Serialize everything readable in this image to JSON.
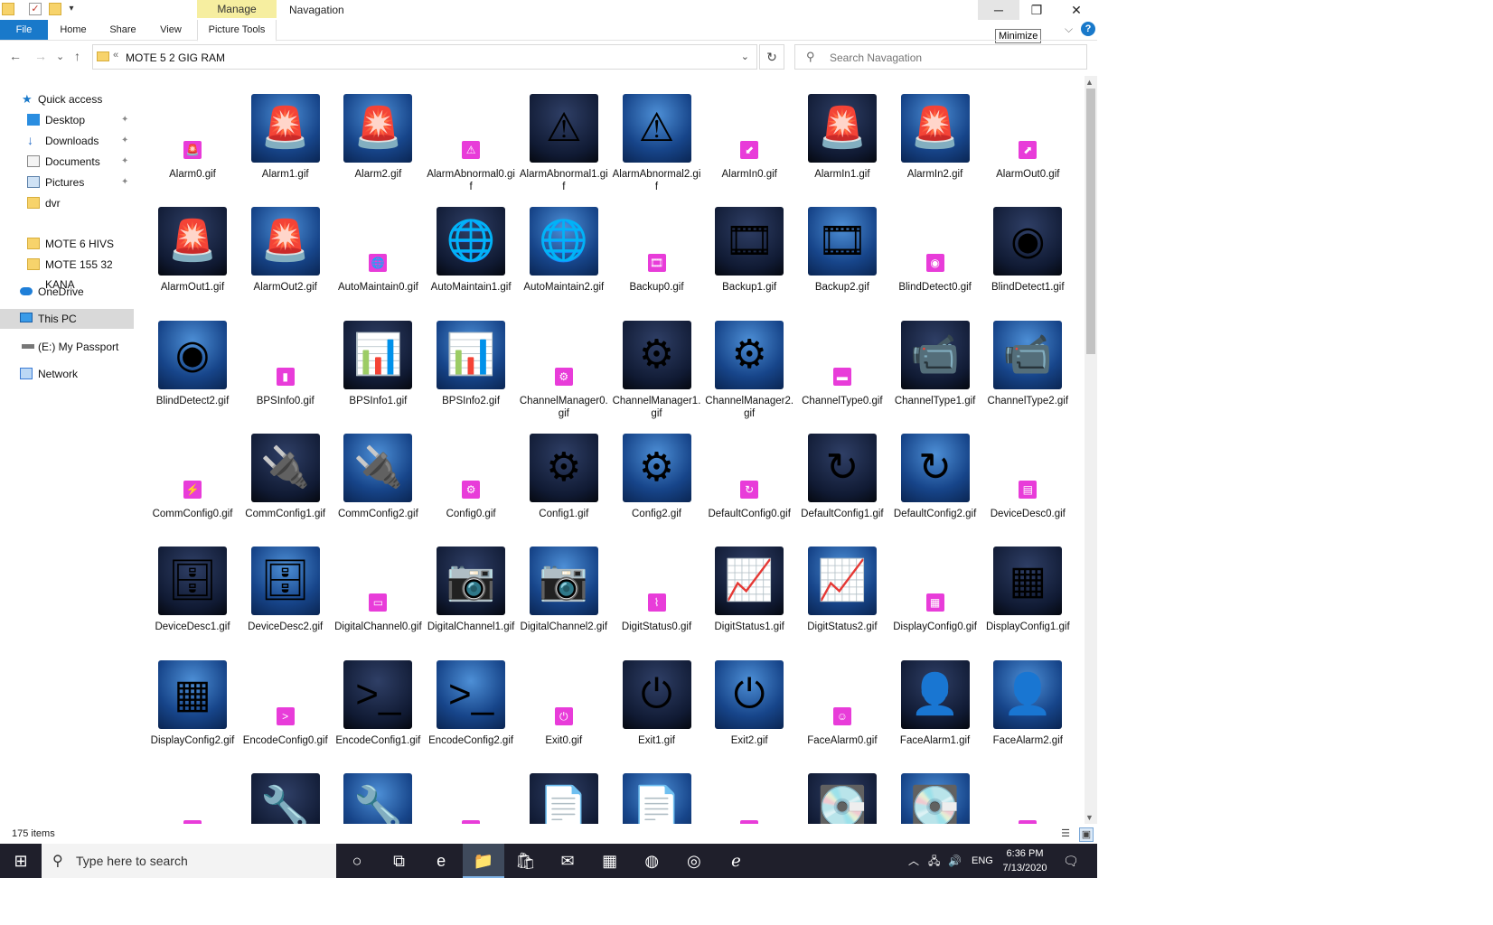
{
  "window": {
    "title": "Navagation",
    "manage_tab": "Manage",
    "minimize_symbol": "─",
    "maximize_symbol": "❐",
    "close_symbol": "✕",
    "tooltip": "Minimize"
  },
  "ribbon": {
    "tabs": [
      "File",
      "Home",
      "Share",
      "View",
      "Picture Tools"
    ],
    "collapse_symbol": "⌵",
    "help_symbol": "?"
  },
  "navbar": {
    "back": "←",
    "forward": "→",
    "recent": "⌄",
    "up": "↑",
    "chevron": "«",
    "path": "MOTE 5 2 GIG RAM",
    "dropdown": "⌄",
    "refresh": "↻",
    "search_placeholder": "Search Navagation",
    "search_icon": "⚲"
  },
  "navpane": {
    "items": [
      {
        "label": "Quick access",
        "icon": "star-icon",
        "glyph": "★"
      },
      {
        "label": "Desktop",
        "icon": "desktop-icon",
        "pinned": true
      },
      {
        "label": "Downloads",
        "icon": "download-arrow-icon",
        "pinned": true
      },
      {
        "label": "Documents",
        "icon": "documents-icon",
        "pinned": true
      },
      {
        "label": "Pictures",
        "icon": "pictures-icon",
        "pinned": true
      },
      {
        "label": "dvr",
        "icon": "folder-icon"
      },
      {
        "label": "MOTE 6 HIVS",
        "icon": "folder-icon"
      },
      {
        "label": "MOTE 155 32 KANA",
        "icon": "folder-icon"
      },
      {
        "label": "OneDrive",
        "icon": "cloud-icon"
      },
      {
        "label": "This PC",
        "icon": "computer-icon"
      },
      {
        "label": "(E:) My Passport",
        "icon": "drive-icon"
      },
      {
        "label": "Network",
        "icon": "network-icon"
      }
    ],
    "pin_glyph": "📌"
  },
  "files": [
    {
      "name": "Alarm0.gif",
      "kind": "small",
      "icon": "alarm-siren-icon",
      "glyph": "🚨"
    },
    {
      "name": "Alarm1.gif",
      "kind": "big-blue",
      "icon": "alarm-siren-blue-icon",
      "glyph": "🚨"
    },
    {
      "name": "Alarm2.gif",
      "kind": "big-blue",
      "icon": "alarm-siren-blue-icon",
      "glyph": "🚨"
    },
    {
      "name": "AlarmAbnormal0.gif",
      "kind": "small",
      "icon": "monitor-warning-icon",
      "glyph": "⚠"
    },
    {
      "name": "AlarmAbnormal1.gif",
      "kind": "big-dark",
      "icon": "monitor-warning-icon",
      "glyph": "⚠"
    },
    {
      "name": "AlarmAbnormal2.gif",
      "kind": "big-blue",
      "icon": "monitor-warning-icon",
      "glyph": "⚠"
    },
    {
      "name": "AlarmIn0.gif",
      "kind": "small",
      "icon": "alarm-in-icon",
      "glyph": "⬋"
    },
    {
      "name": "AlarmIn1.gif",
      "kind": "big-dark",
      "icon": "alarm-in-icon",
      "glyph": "🚨"
    },
    {
      "name": "AlarmIn2.gif",
      "kind": "big-blue",
      "icon": "alarm-in-icon",
      "glyph": "🚨"
    },
    {
      "name": "AlarmOut0.gif",
      "kind": "small",
      "icon": "alarm-out-icon",
      "glyph": "⬈"
    },
    {
      "name": "AlarmOut1.gif",
      "kind": "big-dark",
      "icon": "alarm-out-icon",
      "glyph": "🚨"
    },
    {
      "name": "AlarmOut2.gif",
      "kind": "big-blue",
      "icon": "alarm-out-icon",
      "glyph": "🚨"
    },
    {
      "name": "AutoMaintain0.gif",
      "kind": "small",
      "icon": "globe-cycle-icon",
      "glyph": "🌐"
    },
    {
      "name": "AutoMaintain1.gif",
      "kind": "big-dark",
      "icon": "globe-cycle-icon",
      "glyph": "🌐"
    },
    {
      "name": "AutoMaintain2.gif",
      "kind": "big-blue",
      "icon": "globe-cycle-icon",
      "glyph": "🌐"
    },
    {
      "name": "Backup0.gif",
      "kind": "small",
      "icon": "film-backup-icon",
      "glyph": "🎞"
    },
    {
      "name": "Backup1.gif",
      "kind": "big-dark",
      "icon": "film-backup-icon",
      "glyph": "🎞"
    },
    {
      "name": "Backup2.gif",
      "kind": "big-blue",
      "icon": "film-backup-icon",
      "glyph": "🎞"
    },
    {
      "name": "BlindDetect0.gif",
      "kind": "small",
      "icon": "eye-icon",
      "glyph": "◉"
    },
    {
      "name": "BlindDetect1.gif",
      "kind": "big-dark",
      "icon": "eye-icon",
      "glyph": "◉"
    },
    {
      "name": "BlindDetect2.gif",
      "kind": "big-blue",
      "icon": "eye-icon",
      "glyph": "◉"
    },
    {
      "name": "BPSInfo0.gif",
      "kind": "small",
      "icon": "bar-chart-icon",
      "glyph": "▮"
    },
    {
      "name": "BPSInfo1.gif",
      "kind": "big-dark",
      "icon": "bar-chart-icon",
      "glyph": "📊"
    },
    {
      "name": "BPSInfo2.gif",
      "kind": "big-blue",
      "icon": "bar-chart-icon",
      "glyph": "📊"
    },
    {
      "name": "ChannelManager0.gif",
      "kind": "small",
      "icon": "camera-gear-icon",
      "glyph": "⚙"
    },
    {
      "name": "ChannelManager1.gif",
      "kind": "big-dark",
      "icon": "camera-gear-icon",
      "glyph": "⚙"
    },
    {
      "name": "ChannelManager2.gif",
      "kind": "big-blue",
      "icon": "camera-gear-icon",
      "glyph": "⚙"
    },
    {
      "name": "ChannelType0.gif",
      "kind": "small",
      "icon": "cameras-recorder-icon",
      "glyph": "▬"
    },
    {
      "name": "ChannelType1.gif",
      "kind": "big-dark",
      "icon": "cameras-recorder-icon",
      "glyph": "📹"
    },
    {
      "name": "ChannelType2.gif",
      "kind": "big-blue",
      "icon": "cameras-recorder-icon",
      "glyph": "📹"
    },
    {
      "name": "CommConfig0.gif",
      "kind": "small",
      "icon": "cable-connector-icon",
      "glyph": "⚡"
    },
    {
      "name": "CommConfig1.gif",
      "kind": "big-dark",
      "icon": "cable-connector-icon",
      "glyph": "🔌"
    },
    {
      "name": "CommConfig2.gif",
      "kind": "big-blue",
      "icon": "cable-connector-icon",
      "glyph": "🔌"
    },
    {
      "name": "Config0.gif",
      "kind": "small",
      "icon": "gear-icon",
      "glyph": "⚙"
    },
    {
      "name": "Config1.gif",
      "kind": "big-dark",
      "icon": "gear-icon",
      "glyph": "⚙"
    },
    {
      "name": "Config2.gif",
      "kind": "big-blue",
      "icon": "gear-icon",
      "glyph": "⚙"
    },
    {
      "name": "DefaultConfig0.gif",
      "kind": "small",
      "icon": "reset-arrow-icon",
      "glyph": "↻"
    },
    {
      "name": "DefaultConfig1.gif",
      "kind": "big-dark",
      "icon": "reset-arrow-icon",
      "glyph": "↻"
    },
    {
      "name": "DefaultConfig2.gif",
      "kind": "big-blue",
      "icon": "reset-arrow-icon",
      "glyph": "↻"
    },
    {
      "name": "DeviceDesc0.gif",
      "kind": "small",
      "icon": "server-document-icon",
      "glyph": "▤"
    },
    {
      "name": "DeviceDesc1.gif",
      "kind": "big-dark",
      "icon": "server-document-icon",
      "glyph": "🗄"
    },
    {
      "name": "DeviceDesc2.gif",
      "kind": "big-blue",
      "icon": "server-document-icon",
      "glyph": "🗄"
    },
    {
      "name": "DigitalChannel0.gif",
      "kind": "small",
      "icon": "digital-camera-icon",
      "glyph": "▭"
    },
    {
      "name": "DigitalChannel1.gif",
      "kind": "big-dark",
      "icon": "digital-camera-icon",
      "glyph": "📷"
    },
    {
      "name": "DigitalChannel2.gif",
      "kind": "big-blue",
      "icon": "digital-camera-icon",
      "glyph": "📷"
    },
    {
      "name": "DigitStatus0.gif",
      "kind": "small",
      "icon": "line-graph-icon",
      "glyph": "⌇"
    },
    {
      "name": "DigitStatus1.gif",
      "kind": "big-dark",
      "icon": "line-graph-icon",
      "glyph": "📈"
    },
    {
      "name": "DigitStatus2.gif",
      "kind": "big-blue",
      "icon": "line-graph-icon",
      "glyph": "📈"
    },
    {
      "name": "DisplayConfig0.gif",
      "kind": "small",
      "icon": "display-grid-icon",
      "glyph": "▦"
    },
    {
      "name": "DisplayConfig1.gif",
      "kind": "big-dark",
      "icon": "display-grid-icon",
      "glyph": "▦"
    },
    {
      "name": "DisplayConfig2.gif",
      "kind": "big-blue",
      "icon": "display-grid-icon",
      "glyph": "▦"
    },
    {
      "name": "EncodeConfig0.gif",
      "kind": "small",
      "icon": "terminal-gear-icon",
      "glyph": ">"
    },
    {
      "name": "EncodeConfig1.gif",
      "kind": "big-dark",
      "icon": "terminal-gear-icon",
      "glyph": ">_"
    },
    {
      "name": "EncodeConfig2.gif",
      "kind": "big-blue",
      "icon": "terminal-gear-icon",
      "glyph": ">_"
    },
    {
      "name": "Exit0.gif",
      "kind": "small",
      "icon": "power-icon",
      "glyph": "⏻"
    },
    {
      "name": "Exit1.gif",
      "kind": "big-dark",
      "icon": "power-icon",
      "glyph": "⏻"
    },
    {
      "name": "Exit2.gif",
      "kind": "big-blue",
      "icon": "power-icon",
      "glyph": "⏻"
    },
    {
      "name": "FaceAlarm0.gif",
      "kind": "small",
      "icon": "face-person-icon",
      "glyph": "☺"
    },
    {
      "name": "FaceAlarm1.gif",
      "kind": "big-dark",
      "icon": "face-person-icon",
      "glyph": "👤"
    },
    {
      "name": "FaceAlarm2.gif",
      "kind": "big-blue",
      "icon": "face-person-icon",
      "glyph": "👤"
    },
    {
      "name": "",
      "kind": "small",
      "icon": "partial-small-icon",
      "glyph": ""
    },
    {
      "name": "",
      "kind": "big-dark",
      "icon": "wrench-screwdriver-icon",
      "glyph": "🔧"
    },
    {
      "name": "",
      "kind": "big-blue",
      "icon": "wrench-screwdriver-icon",
      "glyph": "🔧"
    },
    {
      "name": "",
      "kind": "small",
      "icon": "partial-small-icon",
      "glyph": ""
    },
    {
      "name": "",
      "kind": "big-dark",
      "icon": "log-document-icon",
      "glyph": "📄"
    },
    {
      "name": "",
      "kind": "big-blue",
      "icon": "log-document-icon",
      "glyph": "📄"
    },
    {
      "name": "",
      "kind": "small",
      "icon": "partial-small-icon",
      "glyph": ""
    },
    {
      "name": "",
      "kind": "big-dark",
      "icon": "hard-disk-icon",
      "glyph": "💽"
    },
    {
      "name": "",
      "kind": "big-blue",
      "icon": "hard-disk-icon",
      "glyph": "💽"
    },
    {
      "name": "",
      "kind": "small",
      "icon": "partial-small-icon",
      "glyph": ""
    }
  ],
  "status": {
    "item_count": "175 items",
    "details_view": "☰",
    "large_icons_view": "▣"
  },
  "taskbar": {
    "start_glyph": "⊞",
    "search_glyph": "⚲",
    "search_text": "Type here to search",
    "apps": [
      {
        "icon": "cortana-icon",
        "glyph": "○"
      },
      {
        "icon": "task-view-icon",
        "glyph": "⧉"
      },
      {
        "icon": "edge-icon",
        "glyph": "e"
      },
      {
        "icon": "file-explorer-icon",
        "glyph": "📁",
        "active": true
      },
      {
        "icon": "store-icon",
        "glyph": "🛍"
      },
      {
        "icon": "mail-icon",
        "glyph": "✉"
      },
      {
        "icon": "film-icon",
        "glyph": "▦"
      },
      {
        "icon": "firefox-icon",
        "glyph": "◍"
      },
      {
        "icon": "ubuntu-icon",
        "glyph": "◎"
      },
      {
        "icon": "internet-explorer-icon",
        "glyph": "ℯ"
      }
    ],
    "tray": {
      "chevron": "︿",
      "network": "🖧",
      "volume": "🔊",
      "language": "ENG",
      "time": "6:36 PM",
      "date": "7/13/2020",
      "notifications": "🗨"
    }
  },
  "colors": {
    "file_tab": "#1979ca",
    "manage_tab": "#f6eea0",
    "small_icon_bg": "#e83cd9",
    "taskbar": "#1f1f2b",
    "selected_nav": "#d9d9d9"
  }
}
